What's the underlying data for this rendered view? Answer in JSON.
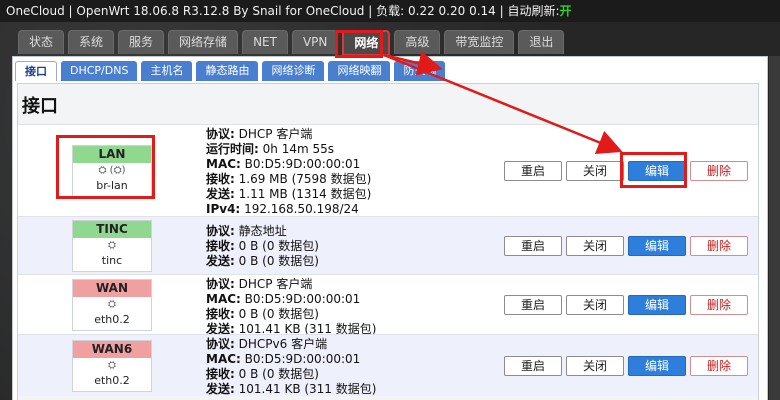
{
  "topbar": {
    "host": "OneCloud",
    "firmware": "OpenWrt 18.06.8 R3.12.8 By Snail for OneCloud",
    "load_label": "负载:",
    "load_values": "0.22 0.20 0.14",
    "autorefresh_label": "自动刷新:",
    "autorefresh_state": "开",
    "separator": "|"
  },
  "main_tabs": [
    {
      "label": "状态"
    },
    {
      "label": "系统"
    },
    {
      "label": "服务"
    },
    {
      "label": "网络存储"
    },
    {
      "label": "NET"
    },
    {
      "label": "VPN"
    },
    {
      "label": "网络",
      "active": true
    },
    {
      "label": "高级"
    },
    {
      "label": "带宽监控"
    },
    {
      "label": "退出"
    }
  ],
  "sub_tabs": [
    {
      "label": "接口",
      "active": true
    },
    {
      "label": "DHCP/DNS"
    },
    {
      "label": "主机名"
    },
    {
      "label": "静态路由"
    },
    {
      "label": "网络诊断"
    },
    {
      "label": "网络映翻"
    },
    {
      "label": "防火墙"
    }
  ],
  "page_title": "接口",
  "buttons": {
    "restart": "重启",
    "stop": "关闭",
    "edit": "编辑",
    "delete": "删除"
  },
  "interfaces": [
    {
      "name": "LAN",
      "color": "green",
      "icons": "⛭ (⛭)",
      "device": "br-lan",
      "info": [
        {
          "k": "协议:",
          "v": "DHCP 客户端"
        },
        {
          "k": "运行时间:",
          "v": "0h 14m 55s"
        },
        {
          "k": "MAC:",
          "v": "B0:D5:9D:00:00:01"
        },
        {
          "k": "接收:",
          "v": "1.69 MB (7598 数据包)"
        },
        {
          "k": "发送:",
          "v": "1.11 MB (1314 数据包)"
        },
        {
          "k": "IPv4:",
          "v": "192.168.50.198/24"
        }
      ]
    },
    {
      "name": "TINC",
      "color": "green",
      "icons": "⛭",
      "device": "tinc",
      "info": [
        {
          "k": "协议:",
          "v": "静态地址"
        },
        {
          "k": "接收:",
          "v": "0 B (0 数据包)"
        },
        {
          "k": "发送:",
          "v": "0 B (0 数据包)"
        }
      ]
    },
    {
      "name": "WAN",
      "color": "red",
      "icons": "⛭",
      "device": "eth0.2",
      "info": [
        {
          "k": "协议:",
          "v": "DHCP 客户端"
        },
        {
          "k": "MAC:",
          "v": "B0:D5:9D:00:00:01"
        },
        {
          "k": "接收:",
          "v": "0 B (0 数据包)"
        },
        {
          "k": "发送:",
          "v": "101.41 KB (311 数据包)"
        }
      ]
    },
    {
      "name": "WAN6",
      "color": "red",
      "icons": "⛭",
      "device": "eth0.2",
      "info": [
        {
          "k": "协议:",
          "v": "DHCPv6 客户端"
        },
        {
          "k": "MAC:",
          "v": "B0:D5:9D:00:00:01"
        },
        {
          "k": "接收:",
          "v": "0 B (0 数据包)"
        },
        {
          "k": "发送:",
          "v": "101.41 KB (311 数据包)"
        }
      ]
    }
  ],
  "colors": {
    "highlight": "#e11a1a",
    "edit_button": "#2e7fdc",
    "subnav": "#4a7fd0"
  }
}
